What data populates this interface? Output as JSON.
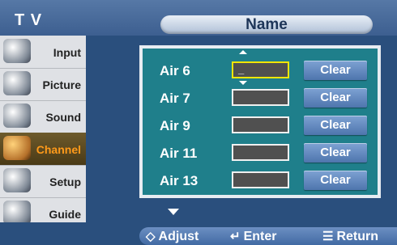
{
  "header": {
    "tv_label": "T V",
    "title": "Name"
  },
  "sidebar": {
    "items": [
      {
        "label": "Input",
        "icon": "input-icon"
      },
      {
        "label": "Picture",
        "icon": "picture-icon"
      },
      {
        "label": "Sound",
        "icon": "sound-icon"
      },
      {
        "label": "Channel",
        "icon": "channel-icon",
        "active": true
      },
      {
        "label": "Setup",
        "icon": "setup-icon"
      },
      {
        "label": "Guide",
        "icon": "guide-icon"
      }
    ]
  },
  "name_list": {
    "rows": [
      {
        "channel": "Air 6",
        "name_value": "_",
        "clear_label": "Clear"
      },
      {
        "channel": "Air 7",
        "name_value": "",
        "clear_label": "Clear"
      },
      {
        "channel": "Air 9",
        "name_value": "",
        "clear_label": "Clear"
      },
      {
        "channel": "Air 11",
        "name_value": "",
        "clear_label": "Clear"
      },
      {
        "channel": "Air 13",
        "name_value": "",
        "clear_label": "Clear"
      }
    ]
  },
  "help_bar": {
    "adjust": "Adjust",
    "enter": "Enter",
    "return": "Return",
    "adjust_icon": "updown-arrows-icon",
    "enter_icon": "enter-icon",
    "return_icon": "menu-return-icon"
  },
  "colors": {
    "background": "#2a4f7d",
    "panel": "#1f7f8b",
    "focus": "#f3e600",
    "active_label": "#ff9a1a"
  }
}
